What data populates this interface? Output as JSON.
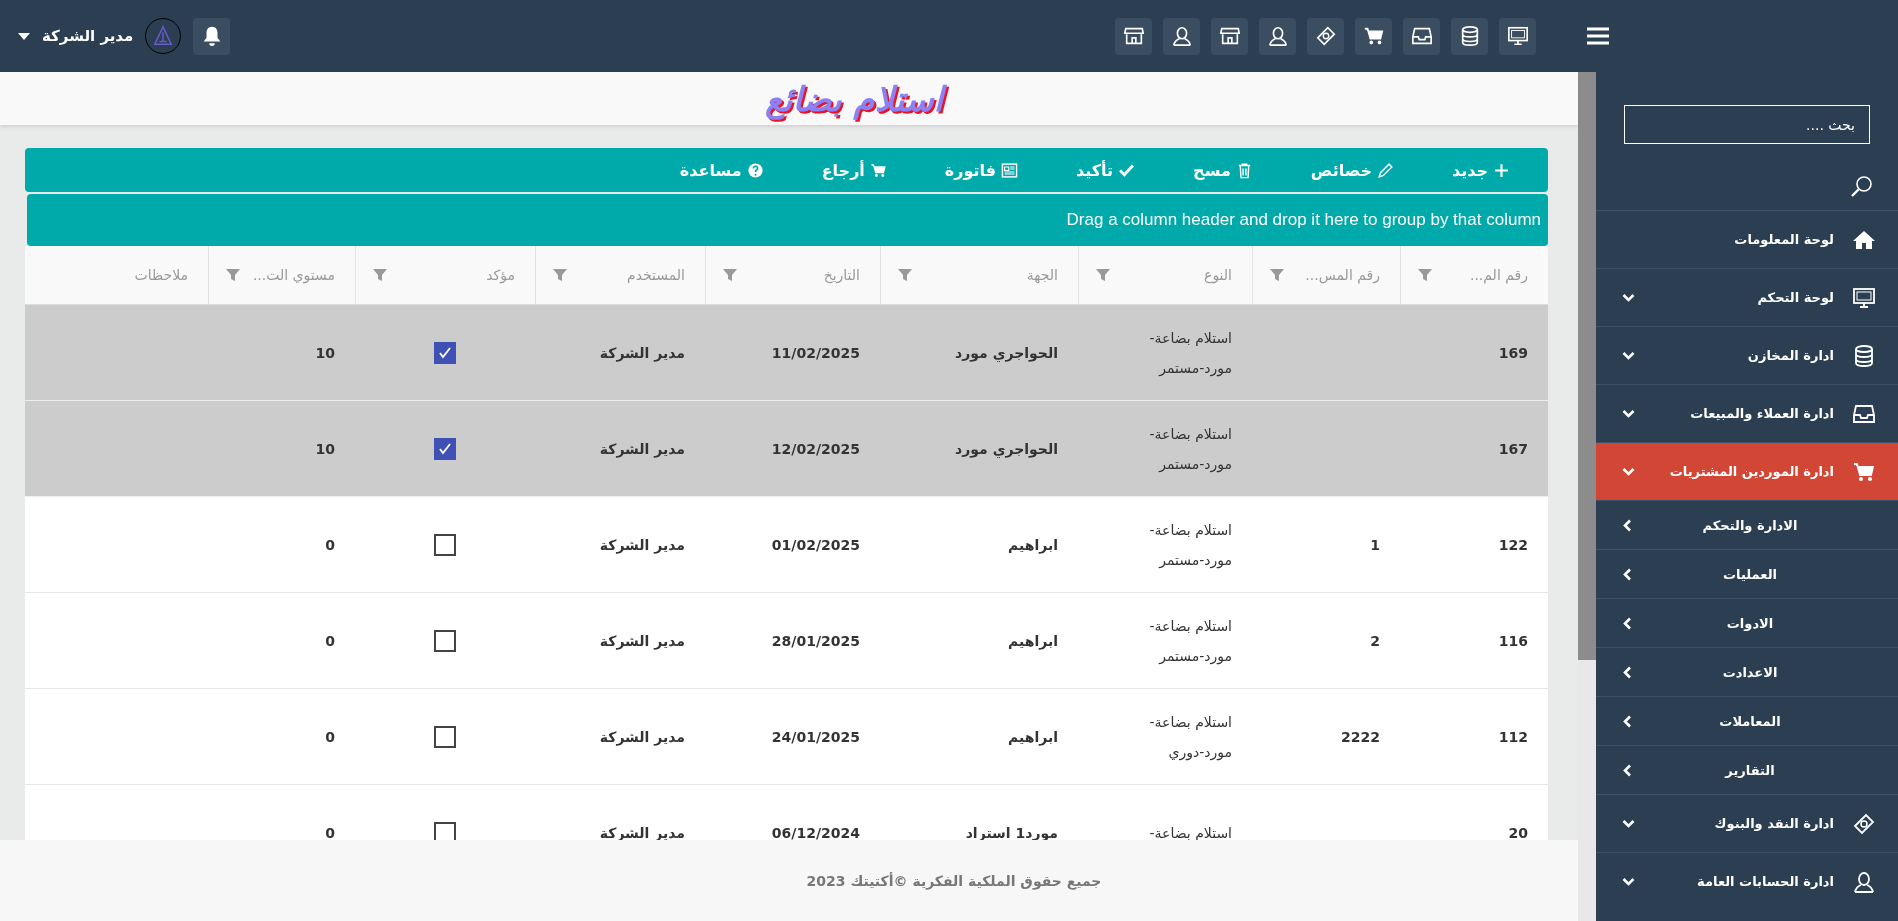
{
  "topbar": {
    "user_name": "مدير الشركة"
  },
  "page_title": "استلام بضائع",
  "toolbar": [
    {
      "label": "جديد"
    },
    {
      "label": "خصائص"
    },
    {
      "label": "مسح"
    },
    {
      "label": "تأكيد"
    },
    {
      "label": "فاتورة"
    },
    {
      "label": "أرجاع"
    },
    {
      "label": "مساعدة"
    }
  ],
  "group_panel": "Drag a column header and drop it here to group by that column",
  "table": {
    "columns": [
      "رقم الم...",
      "رقم المس...",
      "النوع",
      "الجهة",
      "التاريخ",
      "المستخدم",
      "مؤكد",
      "مستوي الت...",
      "ملاحظات"
    ],
    "rows": [
      {
        "selected": true,
        "number": "169",
        "supplier_number": "",
        "type_lines": [
          "استلام بضاعة-",
          "مورد-مستمر"
        ],
        "party": "الحواجري مورد",
        "date": "11/02/2025",
        "user": "مدير الشركة",
        "confirmed": true,
        "column_8": "10"
      },
      {
        "selected": true,
        "number": "167",
        "supplier_number": "",
        "type_lines": [
          "استلام بضاعة-",
          "مورد-مستمر"
        ],
        "party": "الحواجري مورد",
        "date": "12/02/2025",
        "user": "مدير الشركة",
        "confirmed": true,
        "column_8": "10"
      },
      {
        "selected": false,
        "number": "122",
        "supplier_number": "1",
        "type_lines": [
          "استلام بضاعة-",
          "مورد-مستمر"
        ],
        "party": "ابراهيم",
        "date": "01/02/2025",
        "user": "مدير الشركة",
        "confirmed": false,
        "column_8": "0"
      },
      {
        "selected": false,
        "number": "116",
        "supplier_number": "2",
        "type_lines": [
          "استلام بضاعة-",
          "مورد-مستمر"
        ],
        "party": "ابراهيم",
        "date": "28/01/2025",
        "user": "مدير الشركة",
        "confirmed": false,
        "column_8": "0"
      },
      {
        "selected": false,
        "number": "112",
        "supplier_number": "2222",
        "type_lines": [
          "استلام بضاعة-",
          "مورد-دوري"
        ],
        "party": "ابراهيم",
        "date": "24/01/2025",
        "user": "مدير الشركة",
        "confirmed": false,
        "column_8": "0"
      },
      {
        "selected": false,
        "number": "20",
        "supplier_number": "",
        "type_lines": [
          "استلام بضاعة-"
        ],
        "party": "مورد1 استراد",
        "date": "06/12/2024",
        "user": "مدير الشركة",
        "confirmed": false,
        "column_8": "0"
      }
    ]
  },
  "footer": "جميع حقوق الملكية الفكرية ©أكتيتك 2023",
  "sidebar": {
    "search": {
      "placeholder": "بحث ...."
    },
    "items": [
      {
        "label": "لوحة المعلومات",
        "kind": "link",
        "selected": false
      },
      {
        "label": "لوحة التحكم",
        "kind": "group",
        "selected": false
      },
      {
        "label": "ادارة المخازن",
        "kind": "group",
        "selected": false
      },
      {
        "label": "ادارة العملاء والمبيعات",
        "kind": "group",
        "selected": false
      },
      {
        "label": "ادارة الموردين المشتريات",
        "kind": "group",
        "selected": true,
        "children": [
          {
            "label": "الادارة والتحكم"
          },
          {
            "label": "العمليات"
          },
          {
            "label": "الادوات"
          },
          {
            "label": "الاعدادت"
          },
          {
            "label": "المعاملات"
          },
          {
            "label": "التقارير"
          }
        ]
      },
      {
        "label": "ادارة النقد والبنوك",
        "kind": "group",
        "selected": false
      },
      {
        "label": "ادارة الحسابات العامة",
        "kind": "group",
        "selected": false
      }
    ]
  }
}
